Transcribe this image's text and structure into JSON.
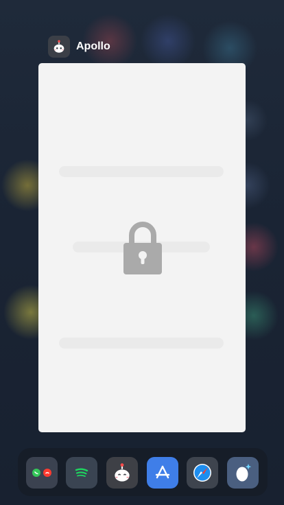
{
  "app_switcher": {
    "title": "Apollo",
    "icon": "apollo-robot-icon",
    "card_state": "locked",
    "card_icon": "lock-icon"
  },
  "dock": {
    "apps": [
      {
        "icon": "phone-call-icon",
        "color": "#3b4250"
      },
      {
        "icon": "spotify-icon",
        "color": "#3a4452"
      },
      {
        "icon": "apollo-robot-icon",
        "color": "#3e4046"
      },
      {
        "icon": "app-store-icon",
        "color": "#3f7ee8"
      },
      {
        "icon": "safari-compass-icon",
        "color": "#3e444e"
      },
      {
        "icon": "egg-sparkle-icon",
        "color": "#4a5f80"
      }
    ]
  },
  "colors": {
    "card_background": "#f3f3f3",
    "lock_gray": "#aaaaaa",
    "wallpaper_base": "#1b2636",
    "title_text": "#ffffff"
  }
}
